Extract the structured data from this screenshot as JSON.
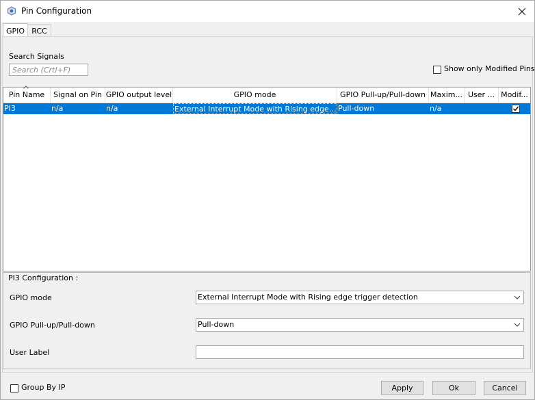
{
  "window": {
    "title": "Pin Configuration",
    "app_icon": "gear-cube-icon",
    "close_icon": "close-icon"
  },
  "tabs": [
    {
      "label": "GPIO",
      "active": true
    },
    {
      "label": "RCC",
      "active": false
    }
  ],
  "search": {
    "label": "Search Signals",
    "placeholder": "Search (Crtl+F)"
  },
  "filter": {
    "show_modified_label": "Show only Modified Pins",
    "checked": false
  },
  "table": {
    "columns": [
      "Pin Name",
      "Signal on Pin",
      "GPIO output level",
      "GPIO mode",
      "GPIO Pull-up/Pull-down",
      "Maxim...",
      "User ...",
      "Modif..."
    ],
    "rows": [
      {
        "pin": "PI3",
        "signal": "n/a",
        "output_level": "n/a",
        "mode": "External Interrupt Mode with Rising edge trigg...",
        "pull": "Pull-down",
        "max": "n/a",
        "user": "",
        "modified": true
      }
    ],
    "selected_color": "#0078d7"
  },
  "config": {
    "title": "PI3 Configuration :",
    "gpio_mode_label": "GPIO mode",
    "gpio_mode_value": "External Interrupt Mode with Rising edge trigger detection",
    "pull_label": "GPIO Pull-up/Pull-down",
    "pull_value": "Pull-down",
    "user_label": "User Label",
    "user_value": ""
  },
  "footer": {
    "group_by_ip": "Group By IP",
    "group_checked": false,
    "apply": "Apply",
    "ok": "Ok",
    "cancel": "Cancel"
  }
}
